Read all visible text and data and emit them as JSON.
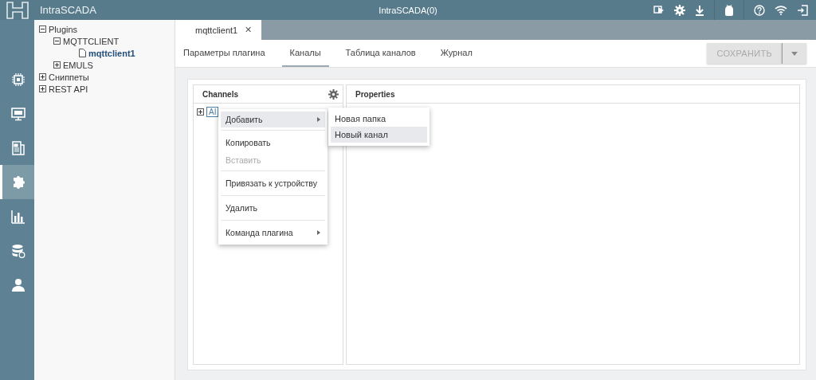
{
  "app": {
    "title": "IntraSCADA",
    "center_title": "IntraSCADA(0)"
  },
  "rail": [
    {
      "kind": "chip",
      "selected": false
    },
    {
      "kind": "monitor",
      "selected": false
    },
    {
      "kind": "document",
      "selected": false
    },
    {
      "kind": "puzzle",
      "selected": true
    },
    {
      "kind": "chart",
      "selected": false
    },
    {
      "kind": "database",
      "selected": false
    },
    {
      "kind": "user",
      "selected": false
    }
  ],
  "tree": [
    {
      "label": "Plugins",
      "expanded": true,
      "children": [
        {
          "label": "MQTTCLIENT",
          "expanded": true,
          "children": [
            {
              "label": "mqttclient1",
              "selected": true
            }
          ]
        },
        {
          "label": "EMULS",
          "expanded": false
        }
      ]
    },
    {
      "label": "Сниппеты",
      "expanded": false
    },
    {
      "label": "REST API",
      "expanded": false
    }
  ],
  "doc_tab": {
    "label": "mqttclient1",
    "close": "✕"
  },
  "tabs": [
    {
      "label": "Параметры плагина",
      "selected": false
    },
    {
      "label": "Каналы",
      "selected": true
    },
    {
      "label": "Таблица каналов",
      "selected": false
    },
    {
      "label": "Журнал",
      "selected": false
    }
  ],
  "save_button": {
    "label": "СОХРАНИТЬ",
    "disabled": true
  },
  "channels_panel": {
    "title": "Channels",
    "node": {
      "label": "AI",
      "expanded": false
    }
  },
  "properties_panel": {
    "title": "Properties"
  },
  "context_menu": [
    {
      "label": "Добавить",
      "submenu": true,
      "highlighted": true,
      "disabled": false
    },
    {
      "label": "Копировать",
      "submenu": false,
      "highlighted": false,
      "disabled": false,
      "divider_before": true
    },
    {
      "label": "Вставить",
      "submenu": false,
      "highlighted": false,
      "disabled": true
    },
    {
      "label": "Привязать к устройству",
      "submenu": false,
      "highlighted": false,
      "disabled": false,
      "divider_before": true
    },
    {
      "label": "Удалить",
      "submenu": false,
      "highlighted": false,
      "disabled": false,
      "divider_before": true
    },
    {
      "label": "Команда плагина",
      "submenu": true,
      "highlighted": false,
      "disabled": false,
      "divider_before": true
    }
  ],
  "submenu": [
    {
      "label": "Новая папка",
      "highlighted": false
    },
    {
      "label": "Новый канал",
      "highlighted": true
    }
  ]
}
